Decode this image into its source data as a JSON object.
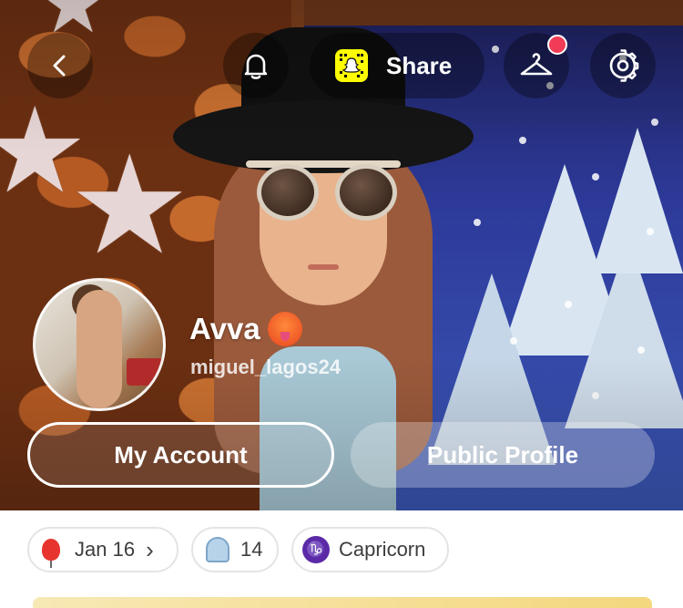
{
  "header": {
    "share_label": "Share",
    "icons": {
      "back": "chevron-left-icon",
      "notifications": "bell-icon",
      "snapcode": "snapcode-icon",
      "outfit": "hanger-icon",
      "settings": "gear-icon"
    },
    "outfit_has_notification": true
  },
  "profile": {
    "display_name": "Avva",
    "name_emoji": "hot-face-emoji",
    "username": "miguel_lagos24"
  },
  "actions": {
    "my_account_label": "My Account",
    "public_profile_label": "Public Profile"
  },
  "chips": {
    "birthday": {
      "icon": "balloon-icon",
      "label": "Jan 16",
      "chevron": "›"
    },
    "friends": {
      "icon": "ghost-icon",
      "label": "14"
    },
    "zodiac": {
      "icon": "capricorn-icon",
      "symbol": "♑",
      "label": "Capricorn"
    }
  },
  "colors": {
    "snap_yellow": "#fffc00",
    "notification_red": "#f23c57",
    "zodiac_purple": "#5b2aa7"
  }
}
